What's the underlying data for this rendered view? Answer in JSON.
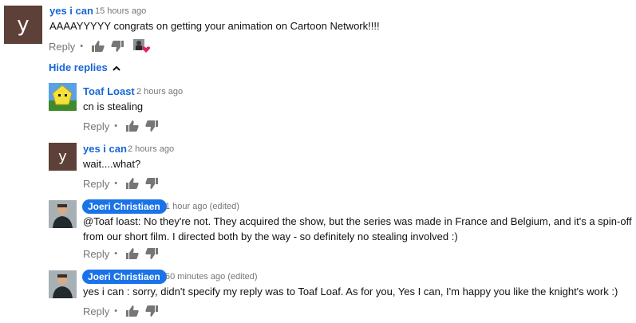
{
  "thread": {
    "top_comment": {
      "avatar_letter": "y",
      "author": "yes i can",
      "time": "15 hours ago",
      "text": "AAAAYYYYY congrats on getting your animation on Cartoon Network!!!!",
      "reply_label": "Reply",
      "heart_icon": "creator-heart-icon"
    },
    "hide_replies_label": "Hide replies",
    "replies": [
      {
        "author": "Toaf Loast",
        "time": "2 hours ago",
        "text": "cn is stealing",
        "reply_label": "Reply"
      },
      {
        "avatar_letter": "y",
        "author": "yes i can",
        "time": "2 hours ago",
        "text": "wait....what?",
        "reply_label": "Reply"
      },
      {
        "author": "Joeri Christiaen",
        "time": "1 hour ago (edited)",
        "text": "@Toaf loast: No they're not. They acquired the show, but the series was made in France and Belgium, and it's a spin-off from our short film. I directed both by the way - so definitely no stealing involved  :)",
        "reply_label": "Reply"
      },
      {
        "author": "Joeri Christiaen",
        "time": "50 minutes ago (edited)",
        "text": "yes i can : sorry, didn't specify my reply was to Toaf Loaf. As for you, Yes I can, I'm happy you like the knight's work :)",
        "reply_label": "Reply"
      }
    ]
  },
  "colors": {
    "link_blue": "#1766d6",
    "badge_blue": "#1a73e8",
    "letter_avatar": "#5d4037",
    "muted": "#767676",
    "heart": "#e0245e"
  }
}
